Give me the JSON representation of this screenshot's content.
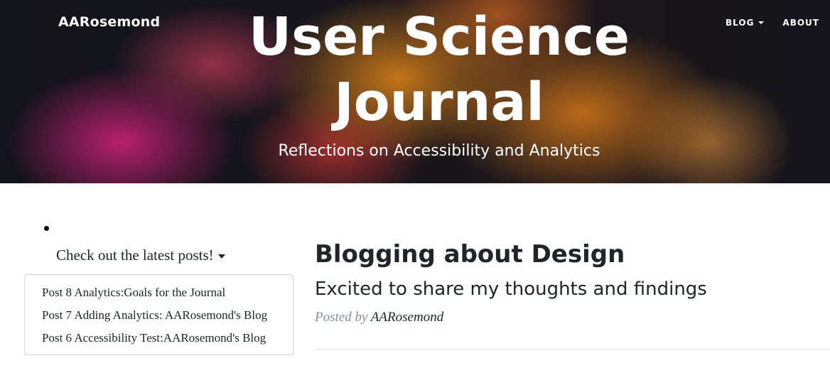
{
  "nav": {
    "brand": "AARosemond",
    "links": [
      {
        "label": "BLOG",
        "has_dropdown": true
      },
      {
        "label": "ABOUT",
        "has_dropdown": false
      }
    ]
  },
  "hero": {
    "title": "User Science Journal",
    "subtitle": "Reflections on Accessibility and Analytics"
  },
  "sidebar": {
    "dropdown_label": "Check out the latest posts!",
    "items": [
      {
        "label": "Post 8 Analytics:Goals for the Journal"
      },
      {
        "label": "Post 7 Adding Analytics: AARosemond's Blog"
      },
      {
        "label": "Post 6 Accessibility Test:AARosemond's Blog"
      }
    ]
  },
  "post": {
    "title": "Blogging about Design",
    "subtitle": "Excited to share my thoughts and findings",
    "posted_by_label": "Posted by",
    "author": "AARosemond"
  },
  "colors": {
    "text_dark": "#212529",
    "meta_gray": "#868e96",
    "hero_text": "#ffffff"
  }
}
